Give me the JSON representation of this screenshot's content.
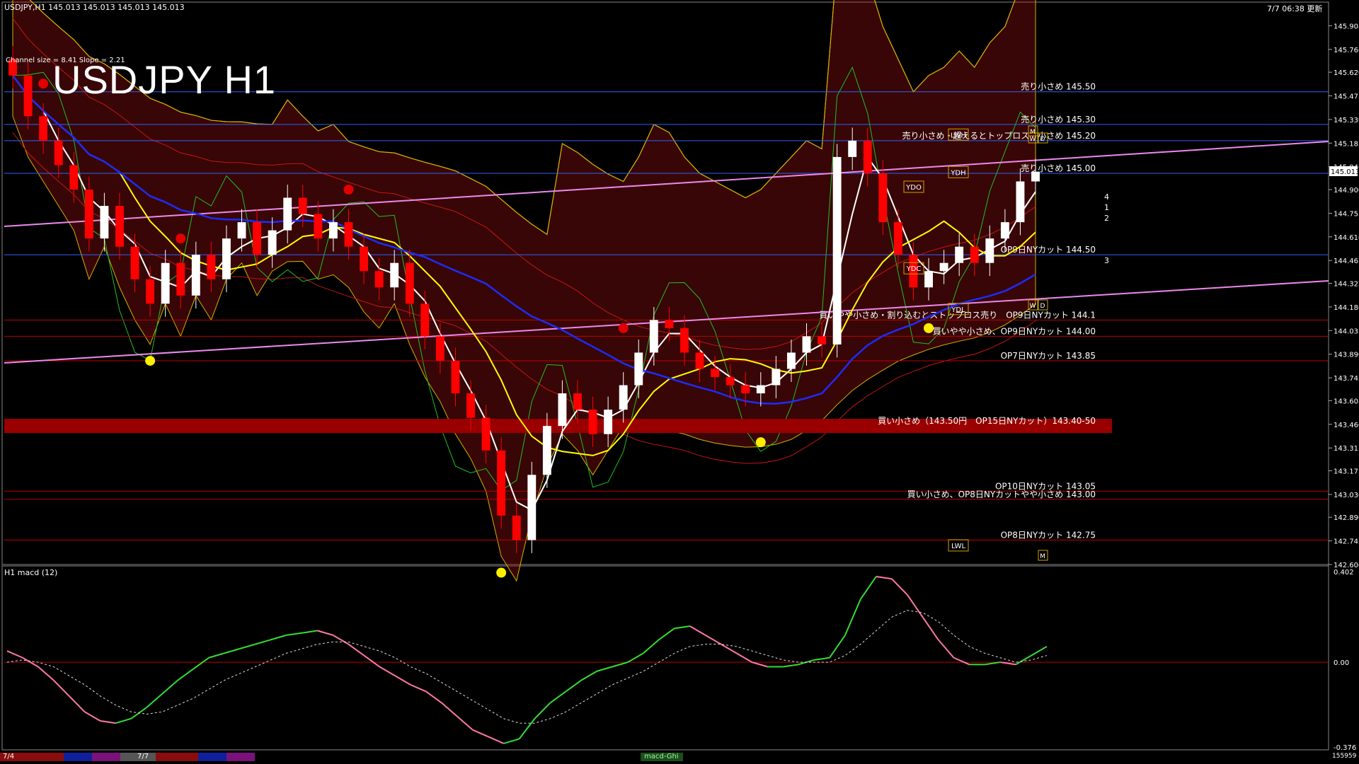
{
  "window": {
    "symbol_line": "USDJPY,H1  145.013 145.013 145.013 145.013",
    "datetime_badge": "7/7 06:38 更新",
    "big_title": "USDJPY H1",
    "channel_text": "Channel size = 8.41 Slope = 2.21",
    "sub_window_label": "H1  macd (12)",
    "bottom_counter": "155959",
    "bottom_tab": "macd-Ghi"
  },
  "colors": {
    "up_candle": "#ffffff",
    "down_candle": "#ff0000",
    "ma_white": "#ffffff",
    "ma_yellow": "#ffff00",
    "ma_blue": "#1e2bff",
    "trend_pink": "#ee88ee",
    "kumo_red": "#a01010",
    "kumo_border": "#d4b000",
    "chikou_green": "#22c022",
    "bb_red": "#c81414",
    "level_red": "#c00000",
    "level_blue": "#3060ff",
    "macd_green": "#33dd33",
    "macd_pink": "#ff77aa",
    "macd_signal": "#dddddd"
  },
  "chart_data": [
    {
      "type": "line",
      "title": "USDJPY H1",
      "ylim": [
        142.6,
        146.05
      ],
      "y_ticks": [
        "145.905",
        "145.760",
        "145.620",
        "145.475",
        "145.330",
        "145.185",
        "145.040",
        "144.900",
        "144.755",
        "144.610",
        "144.465",
        "144.325",
        "144.180",
        "144.035",
        "143.890",
        "143.745",
        "143.605",
        "143.460",
        "143.315",
        "143.175",
        "143.030",
        "142.890",
        "142.745",
        "142.600"
      ],
      "current_price": "145.013",
      "candles_close": [
        145.6,
        145.35,
        145.2,
        145.05,
        144.9,
        144.6,
        144.8,
        144.55,
        144.35,
        144.2,
        144.45,
        144.25,
        144.5,
        144.35,
        144.6,
        144.7,
        144.5,
        144.65,
        144.85,
        144.75,
        144.6,
        144.7,
        144.55,
        144.4,
        144.3,
        144.45,
        144.2,
        144.0,
        143.85,
        143.65,
        143.5,
        143.3,
        142.9,
        142.75,
        143.15,
        143.45,
        143.65,
        143.55,
        143.4,
        143.55,
        143.7,
        143.9,
        144.1,
        144.05,
        143.9,
        143.8,
        143.75,
        143.7,
        143.65,
        143.7,
        143.8,
        143.9,
        144.0,
        143.95,
        145.1,
        145.2,
        145.0,
        144.7,
        144.5,
        144.3,
        144.4,
        144.45,
        144.55,
        144.45,
        144.6,
        144.7,
        144.95,
        145.01
      ],
      "price_levels": [
        {
          "price": 145.5,
          "label": "売り小さめ 145.50",
          "color": "blue"
        },
        {
          "price": 145.3,
          "label": "売り小さめ 145.30",
          "color": "blue"
        },
        {
          "price": 145.2,
          "label": "売り小さめ・超えるとトップロス　小さめ 145.20",
          "color": "blue"
        },
        {
          "price": 145.0,
          "label": "売り小さめ 145.00",
          "color": "blue"
        },
        {
          "price": 144.5,
          "label": "OP9日NYカット 144.50",
          "color": "blue"
        },
        {
          "price": 144.1,
          "label": "買いやや小さめ・割り込むとストップロス売り　OP9日NYカット 144.1",
          "color": "red"
        },
        {
          "price": 144.0,
          "label": "買いやや小さめ、OP9日NYカット 144.00",
          "color": "red"
        },
        {
          "price": 143.85,
          "label": "OP7日NYカット 143.85",
          "color": "red"
        },
        {
          "price": 143.45,
          "label": "買い小さめ（143.50円　OP15日NYカット）143.40-50",
          "color": "band"
        },
        {
          "price": 143.05,
          "label": "OP10日NYカット 143.05",
          "color": "red"
        },
        {
          "price": 143.0,
          "label": "買い小さめ、OP8日NYカットやや小さめ 143.00",
          "color": "red"
        },
        {
          "price": 142.75,
          "label": "OP8日NYカット 142.75",
          "color": "red"
        }
      ],
      "boxes": [
        {
          "label": "LWH",
          "price": 145.22
        },
        {
          "label": "YDH",
          "price": 144.99
        },
        {
          "label": "YDO",
          "price": 144.9
        },
        {
          "label": "YDC",
          "price": 144.4
        },
        {
          "label": "YDL",
          "price": 144.15
        },
        {
          "label": "LWL",
          "price": 142.7
        }
      ],
      "box_small": [
        "W",
        "D",
        "W",
        "D",
        "M",
        "M"
      ],
      "fan_labels": [
        "4",
        "1",
        "2",
        "3"
      ]
    },
    {
      "type": "line",
      "title": "H1  macd (12)",
      "ylim": [
        -0.376,
        0.402
      ],
      "y_ticks": [
        "0.402",
        "0.00",
        "-0.376"
      ],
      "series": [
        {
          "values": [
            0.05,
            0.02,
            -0.02,
            -0.08,
            -0.15,
            -0.22,
            -0.26,
            -0.27,
            -0.25,
            -0.2,
            -0.14,
            -0.08,
            -0.03,
            0.02,
            0.04,
            0.06,
            0.08,
            0.1,
            0.12,
            0.13,
            0.14,
            0.12,
            0.08,
            0.03,
            -0.02,
            -0.06,
            -0.1,
            -0.13,
            -0.18,
            -0.24,
            -0.3,
            -0.33,
            -0.36,
            -0.34,
            -0.25,
            -0.18,
            -0.13,
            -0.08,
            -0.04,
            -0.02,
            0.0,
            0.04,
            0.1,
            0.15,
            0.16,
            0.12,
            0.08,
            0.04,
            0.0,
            -0.02,
            -0.02,
            -0.01,
            0.01,
            0.02,
            0.12,
            0.28,
            0.38,
            0.37,
            0.3,
            0.2,
            0.1,
            0.02,
            -0.01,
            -0.01,
            0.0,
            -0.01,
            0.03,
            0.07
          ]
        },
        {
          "values": [
            0.0,
            0.01,
            0.0,
            -0.02,
            -0.06,
            -0.1,
            -0.15,
            -0.19,
            -0.22,
            -0.23,
            -0.22,
            -0.19,
            -0.16,
            -0.12,
            -0.08,
            -0.05,
            -0.02,
            0.01,
            0.04,
            0.06,
            0.08,
            0.09,
            0.09,
            0.07,
            0.05,
            0.02,
            -0.02,
            -0.05,
            -0.09,
            -0.13,
            -0.17,
            -0.21,
            -0.25,
            -0.27,
            -0.27,
            -0.25,
            -0.22,
            -0.18,
            -0.14,
            -0.1,
            -0.07,
            -0.04,
            0.0,
            0.04,
            0.07,
            0.08,
            0.08,
            0.07,
            0.05,
            0.03,
            0.01,
            0.0,
            0.0,
            0.0,
            0.03,
            0.08,
            0.14,
            0.2,
            0.23,
            0.22,
            0.18,
            0.12,
            0.07,
            0.04,
            0.02,
            0.0,
            0.01,
            0.03
          ]
        }
      ]
    }
  ],
  "bottom_labels": [
    "7/4",
    "7/7"
  ]
}
